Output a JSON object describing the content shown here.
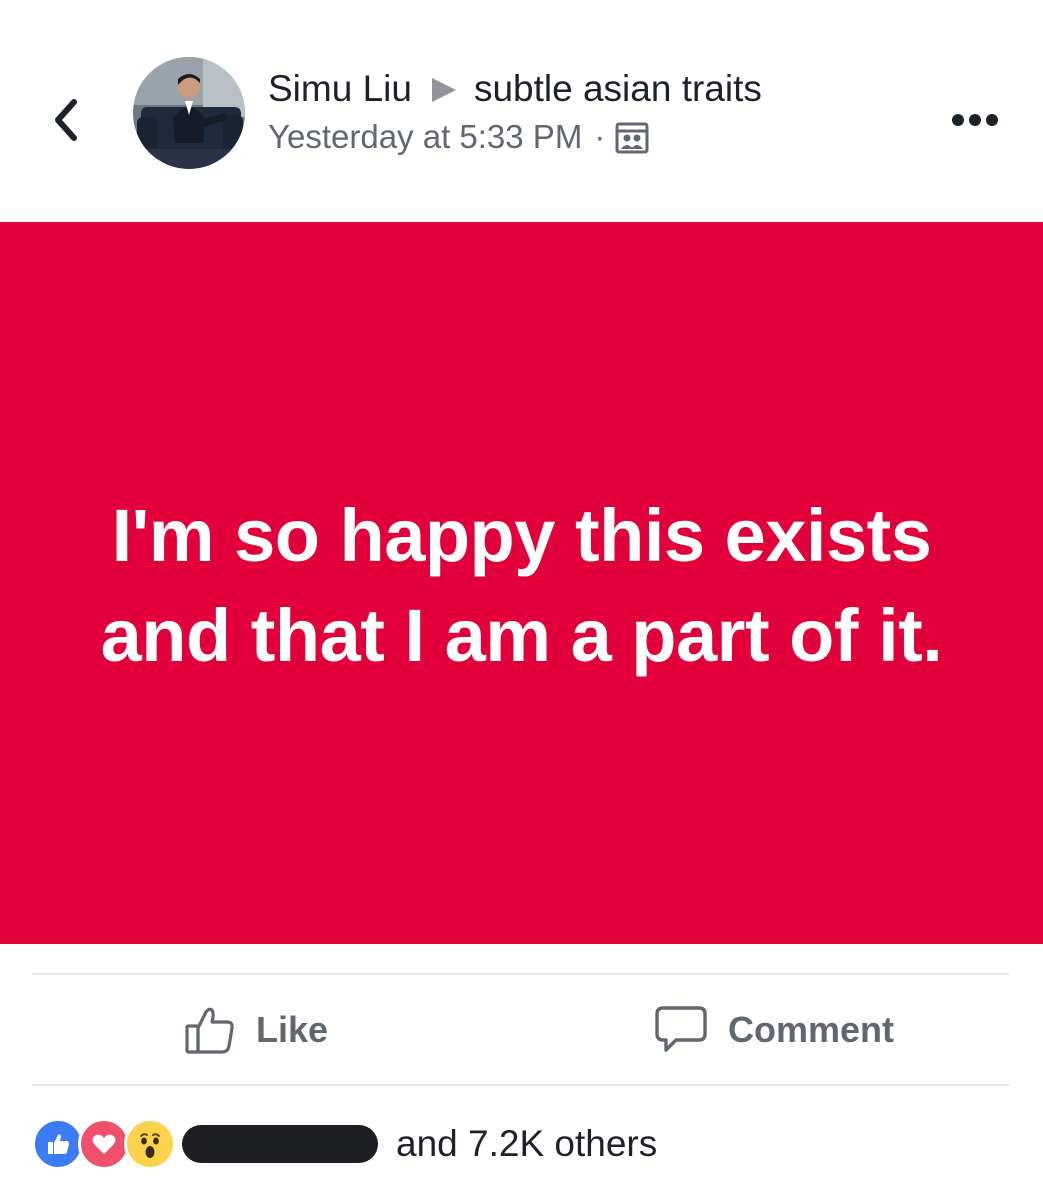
{
  "header": {
    "author_name": "Simu Liu",
    "group_name": "subtle asian traits",
    "timestamp": "Yesterday at 5:33 PM",
    "separator": "·",
    "audience_icon": "group-members-icon"
  },
  "post": {
    "text": "I'm so happy this exists and that I am a part of it.",
    "background_color": "#e2003b",
    "text_color": "#ffffff"
  },
  "actions": {
    "like_label": "Like",
    "comment_label": "Comment"
  },
  "reactions": {
    "types": [
      "like",
      "love",
      "wow"
    ],
    "summary": "and 7.2K others"
  },
  "colors": {
    "like_blue": "#3b7cf5",
    "love_red": "#f0506e",
    "wow_yellow": "#fbd24b"
  }
}
